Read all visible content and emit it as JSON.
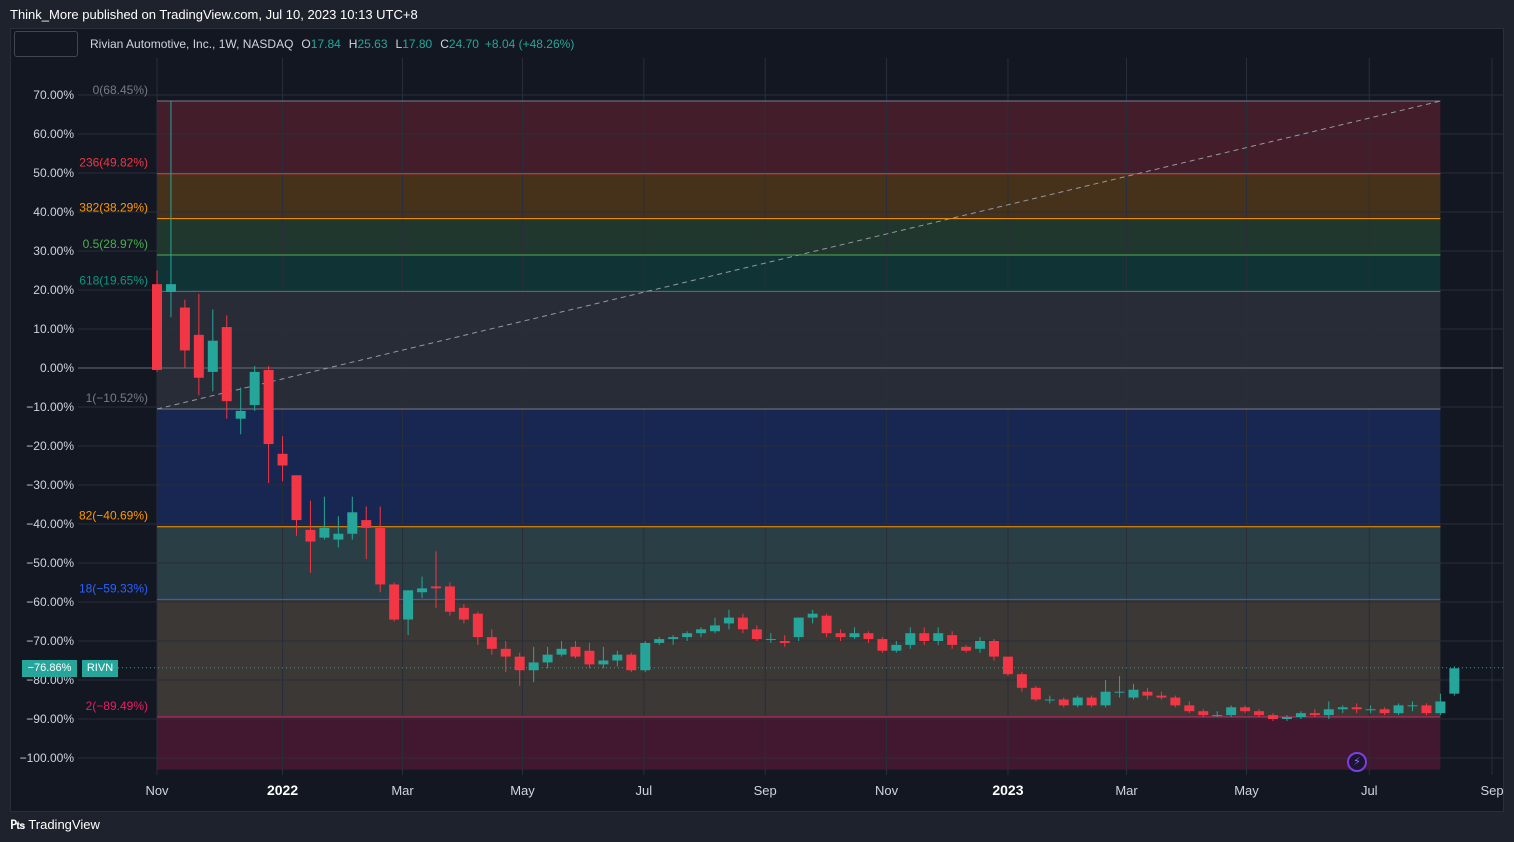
{
  "header": {
    "published": "Think_More published on TradingView.com, Jul 10, 2023 10:13 UTC+8"
  },
  "legend": {
    "symbol": "Rivian Automotive, Inc., 1W, NASDAQ",
    "o_label": "O",
    "o_value": "17.84",
    "h_label": "H",
    "h_value": "25.63",
    "l_label": "L",
    "l_value": "17.80",
    "c_label": "C",
    "c_value": "24.70",
    "change": "+8.04 (+48.26%)"
  },
  "price_tag": {
    "value": "−76.86%",
    "symbol": "RIVN"
  },
  "footer": {
    "brand": "TradingView",
    "logo": "tradingview-logo-icon"
  },
  "colors": {
    "up": "#26a69a",
    "down": "#f23645",
    "background": "#131722"
  },
  "chart_data": {
    "type": "candlestick",
    "symbol": "RIVN",
    "interval": "1W",
    "y_unit": "percent",
    "ylim": [
      -103,
      83
    ],
    "y_ticks": [
      {
        "v": 70,
        "label": "70.00%"
      },
      {
        "v": 60,
        "label": "60.00%"
      },
      {
        "v": 50,
        "label": "50.00%"
      },
      {
        "v": 40,
        "label": "40.00%"
      },
      {
        "v": 30,
        "label": "30.00%"
      },
      {
        "v": 20,
        "label": "20.00%"
      },
      {
        "v": 10,
        "label": "10.00%"
      },
      {
        "v": 0,
        "label": "0.00%"
      },
      {
        "v": -10,
        "label": "−10.00%"
      },
      {
        "v": -20,
        "label": "−20.00%"
      },
      {
        "v": -30,
        "label": "−30.00%"
      },
      {
        "v": -40,
        "label": "−40.00%"
      },
      {
        "v": -50,
        "label": "−50.00%"
      },
      {
        "v": -60,
        "label": "−60.00%"
      },
      {
        "v": -70,
        "label": "−70.00%"
      },
      {
        "v": -80,
        "label": "−80.00%"
      },
      {
        "v": -90,
        "label": "−90.00%"
      },
      {
        "v": -100,
        "label": "−100.00%"
      }
    ],
    "x_ticks": [
      {
        "label": "Nov",
        "bold": false,
        "t": 0
      },
      {
        "label": "2022",
        "bold": true,
        "t": 9
      },
      {
        "label": "Mar",
        "bold": false,
        "t": 17.6
      },
      {
        "label": "May",
        "bold": false,
        "t": 26.2
      },
      {
        "label": "Jul",
        "bold": false,
        "t": 34.9
      },
      {
        "label": "Sep",
        "bold": false,
        "t": 43.6
      },
      {
        "label": "Nov",
        "bold": false,
        "t": 52.3
      },
      {
        "label": "2023",
        "bold": true,
        "t": 61
      },
      {
        "label": "Mar",
        "bold": false,
        "t": 69.5
      },
      {
        "label": "May",
        "bold": false,
        "t": 78.1
      },
      {
        "label": "Jul",
        "bold": false,
        "t": 86.9
      },
      {
        "label": "Sep",
        "bold": false,
        "t": 95.7
      }
    ],
    "fib_levels": [
      {
        "label": "0(68.45%)",
        "value": 68.45,
        "color": "#787b86"
      },
      {
        "label": "236(49.82%)",
        "value": 49.82,
        "color": "#f23645"
      },
      {
        "label": "382(38.29%)",
        "value": 38.29,
        "color": "#ff9800"
      },
      {
        "label": "0.5(28.97%)",
        "value": 28.97,
        "color": "#4caf50"
      },
      {
        "label": "618(19.65%)",
        "value": 19.65,
        "color": "#089981"
      },
      {
        "label": "1(−10.52%)",
        "value": -10.52,
        "color": "#787b86"
      },
      {
        "label": "82(−40.69%)",
        "value": -40.69,
        "color": "#ff9800"
      },
      {
        "label": "18(−59.33%)",
        "value": -59.33,
        "color": "#2962ff"
      },
      {
        "label": "2(−89.49%)",
        "value": -89.49,
        "color": "#e91e63"
      }
    ],
    "fib_zones": [
      {
        "top": 68.45,
        "bottom": 49.82,
        "color": "#f23645"
      },
      {
        "top": 49.82,
        "bottom": 38.29,
        "color": "#ff9800"
      },
      {
        "top": 38.29,
        "bottom": 28.97,
        "color": "#4caf50"
      },
      {
        "top": 28.97,
        "bottom": 19.65,
        "color": "#089981"
      },
      {
        "top": 19.65,
        "bottom": -10.52,
        "color": "#787b86"
      },
      {
        "top": -10.52,
        "bottom": -40.69,
        "color": "#2962ff"
      },
      {
        "top": -40.69,
        "bottom": -59.33,
        "color": "#80cbc4"
      },
      {
        "top": -59.33,
        "bottom": -89.49,
        "color": "#cdb27a"
      },
      {
        "top": -89.49,
        "bottom": -103,
        "color": "#e91e63"
      }
    ],
    "trendline": {
      "from": {
        "t": 0,
        "v": -10.52
      },
      "to": {
        "t": 92,
        "v": 68.45
      }
    },
    "fib_span": {
      "t_start": 0,
      "t_end": 92
    },
    "last_price": -76.86,
    "candles": [
      [
        0,
        21.5,
        -0.5,
        25,
        -1
      ],
      [
        1,
        19.5,
        21.5,
        68.45,
        13
      ],
      [
        2,
        15.5,
        4.5,
        17.5,
        0
      ],
      [
        3,
        8.5,
        -2.5,
        19,
        -7
      ],
      [
        4,
        -1,
        7,
        15,
        -6
      ],
      [
        5,
        10.5,
        -8.5,
        13.5,
        -13
      ],
      [
        6,
        -13,
        -11,
        -5,
        -17
      ],
      [
        7,
        -9.5,
        -1,
        0.5,
        -11
      ],
      [
        8,
        -0.5,
        -19.5,
        0.5,
        -29.5
      ],
      [
        9,
        -22,
        -25,
        -17.5,
        -29
      ],
      [
        10,
        -27.5,
        -39,
        -27.5,
        -43
      ],
      [
        11,
        -41.5,
        -44.5,
        -34,
        -52.5
      ],
      [
        12,
        -43.5,
        -41,
        -33,
        -44
      ],
      [
        13,
        -44,
        -42.5,
        -38,
        -46
      ],
      [
        14,
        -42.5,
        -37,
        -33,
        -44
      ],
      [
        15,
        -39,
        -41,
        -35.5,
        -49
      ],
      [
        16,
        -41,
        -55.5,
        -35.5,
        -57.5
      ],
      [
        17,
        -55.5,
        -64.5,
        -55,
        -65
      ],
      [
        18,
        -64.5,
        -57,
        -57,
        -68.5
      ],
      [
        19,
        -57.5,
        -56.5,
        -53.5,
        -59
      ],
      [
        20,
        -56,
        -56.5,
        -47,
        -61.5
      ],
      [
        21,
        -56,
        -62.5,
        -55,
        -63.5
      ],
      [
        22,
        -61.5,
        -64.5,
        -60.5,
        -65.5
      ],
      [
        23,
        -63,
        -69,
        -62.5,
        -71
      ],
      [
        24,
        -69,
        -72,
        -67,
        -73.5
      ],
      [
        25,
        -72,
        -74,
        -70,
        -78
      ],
      [
        26,
        -74,
        -77.5,
        -73,
        -81.5
      ],
      [
        27,
        -77.5,
        -75.5,
        -71.5,
        -80.5
      ],
      [
        28,
        -75.5,
        -73.5,
        -71.5,
        -77
      ],
      [
        29,
        -73.5,
        -72,
        -70,
        -74
      ],
      [
        30,
        -71.5,
        -74,
        -70,
        -74.5
      ],
      [
        31,
        -72.5,
        -76,
        -70.5,
        -77
      ],
      [
        32,
        -76,
        -75,
        -71.5,
        -77
      ],
      [
        33,
        -75,
        -73.5,
        -72.5,
        -76.5
      ],
      [
        34,
        -73.5,
        -77.5,
        -73,
        -78
      ],
      [
        35,
        -77.5,
        -70.5,
        -70,
        -78
      ],
      [
        36,
        -70.5,
        -69.5,
        -69,
        -71
      ],
      [
        37,
        -69.5,
        -69,
        -68.5,
        -71
      ],
      [
        38,
        -69,
        -68,
        -67.5,
        -70
      ],
      [
        39,
        -68,
        -67,
        -66.5,
        -69
      ],
      [
        40,
        -67.5,
        -66,
        -64,
        -68
      ],
      [
        41,
        -65.5,
        -64,
        -62,
        -67
      ],
      [
        42,
        -64,
        -67,
        -63,
        -68
      ],
      [
        43,
        -67,
        -69.5,
        -66,
        -70
      ],
      [
        44,
        -69.5,
        -69.5,
        -68,
        -70.5
      ],
      [
        45,
        -70,
        -70.5,
        -68.5,
        -71.5
      ],
      [
        46,
        -69,
        -64,
        -64,
        -70
      ],
      [
        47,
        -64,
        -63,
        -62,
        -65.5
      ],
      [
        48,
        -63.5,
        -68,
        -63,
        -69
      ],
      [
        49,
        -68,
        -69,
        -67,
        -70
      ],
      [
        50,
        -69,
        -68,
        -66.5,
        -69.5
      ],
      [
        51,
        -68,
        -69.5,
        -67.5,
        -70.5
      ],
      [
        52,
        -69.5,
        -72.5,
        -69,
        -73
      ],
      [
        53,
        -72.5,
        -71,
        -70,
        -73
      ],
      [
        54,
        -71,
        -68,
        -66.5,
        -72
      ],
      [
        55,
        -68,
        -70,
        -66.5,
        -71
      ],
      [
        56,
        -70,
        -68,
        -66.5,
        -71
      ],
      [
        57,
        -68.5,
        -71,
        -67.5,
        -72
      ],
      [
        58,
        -71.5,
        -72.5,
        -71,
        -73
      ],
      [
        59,
        -72,
        -70,
        -69,
        -73
      ],
      [
        60,
        -70,
        -74,
        -69.5,
        -75
      ],
      [
        61,
        -74,
        -78.5,
        -74,
        -79
      ],
      [
        62,
        -78.5,
        -82,
        -78,
        -83
      ],
      [
        63,
        -82,
        -85,
        -81.5,
        -85.5
      ],
      [
        64,
        -85,
        -85,
        -84,
        -86
      ],
      [
        65,
        -85,
        -86.5,
        -84.5,
        -87
      ],
      [
        66,
        -86.5,
        -84.5,
        -84,
        -87
      ],
      [
        67,
        -84.5,
        -86.5,
        -84,
        -87
      ],
      [
        68,
        -86.5,
        -83,
        -80,
        -87
      ],
      [
        69,
        -83,
        -83,
        -79,
        -84.5
      ],
      [
        70,
        -84.5,
        -82.5,
        -81,
        -85
      ],
      [
        71,
        -83,
        -84,
        -82,
        -85
      ],
      [
        72,
        -84,
        -84.5,
        -83,
        -85
      ],
      [
        73,
        -84.5,
        -86.5,
        -84,
        -87
      ],
      [
        74,
        -86.5,
        -88,
        -85.5,
        -88.5
      ],
      [
        75,
        -88,
        -89,
        -87.5,
        -89.5
      ],
      [
        76,
        -89,
        -89,
        -88,
        -89.5
      ],
      [
        77,
        -89,
        -87,
        -86.5,
        -89.5
      ],
      [
        78,
        -87,
        -88,
        -86.5,
        -88.5
      ],
      [
        79,
        -88,
        -89,
        -87.5,
        -89.5
      ],
      [
        80,
        -89,
        -90,
        -88.5,
        -90.5
      ],
      [
        81,
        -90,
        -89.5,
        -89,
        -90.5
      ],
      [
        82,
        -89.5,
        -88.5,
        -88,
        -90
      ],
      [
        83,
        -88.5,
        -89,
        -87.5,
        -89.5
      ],
      [
        84,
        -89,
        -87.5,
        -85.5,
        -90
      ],
      [
        85,
        -87.5,
        -87,
        -86.5,
        -88.5
      ],
      [
        86,
        -87,
        -87.5,
        -86,
        -88.5
      ],
      [
        87,
        -87.5,
        -87.5,
        -86.5,
        -88.5
      ],
      [
        88,
        -87.5,
        -88.5,
        -87,
        -89
      ],
      [
        89,
        -88.5,
        -86.5,
        -86,
        -89
      ],
      [
        90,
        -86.5,
        -86.5,
        -85.5,
        -88
      ],
      [
        91,
        -86.5,
        -88.5,
        -86,
        -89
      ],
      [
        92,
        -88.5,
        -85.5,
        -83.5,
        -89
      ],
      [
        93,
        -83.5,
        -77,
        -76.5,
        -84
      ]
    ]
  }
}
